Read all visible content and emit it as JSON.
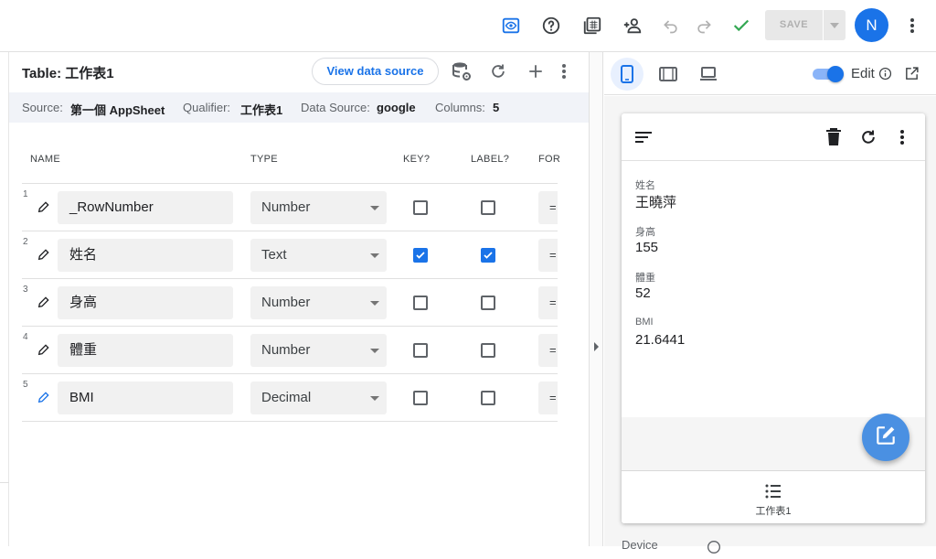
{
  "topbar": {
    "icons": [
      "preview-icon",
      "help-icon",
      "gallery-icon",
      "share-user-icon",
      "undo-icon",
      "redo-icon",
      "check-icon"
    ],
    "save_label": "SAVE",
    "avatar_letter": "N",
    "accent": "#1a73e8"
  },
  "table_header": {
    "title": "Table: 工作表1",
    "view_source_label": "View data source"
  },
  "info_bar": {
    "source_label": "Source:",
    "source_value": "第一個 AppSheet",
    "qualifier_label": "Qualifier:",
    "qualifier_value": "工作表1",
    "datasource_label": "Data Source:",
    "datasource_value": "google",
    "columns_label": "Columns:",
    "columns_value": "5"
  },
  "columns_header": {
    "name": "NAME",
    "type": "TYPE",
    "key": "KEY?",
    "label": "LABEL?",
    "formula": "FOR"
  },
  "rows": [
    {
      "num": "1",
      "name": "_RowNumber",
      "type": "Number",
      "key": false,
      "label": false,
      "formula": "="
    },
    {
      "num": "2",
      "name": "姓名",
      "type": "Text",
      "key": true,
      "label": true,
      "formula": "="
    },
    {
      "num": "3",
      "name": "身高",
      "type": "Number",
      "key": false,
      "label": false,
      "formula": "="
    },
    {
      "num": "4",
      "name": "體重",
      "type": "Number",
      "key": false,
      "label": false,
      "formula": "="
    },
    {
      "num": "5",
      "name": "BMI",
      "type": "Decimal",
      "key": false,
      "label": false,
      "formula": "="
    }
  ],
  "preview": {
    "edit_label": "Edit",
    "edit_on": true,
    "fields": [
      {
        "label": "姓名",
        "value": "王曉萍"
      },
      {
        "label": "身高",
        "value": "155"
      },
      {
        "label": "體重",
        "value": "52"
      },
      {
        "label": "BMI",
        "value": "21.6441"
      }
    ],
    "nav_label": "工作表1",
    "bottom_cut": "Device"
  }
}
